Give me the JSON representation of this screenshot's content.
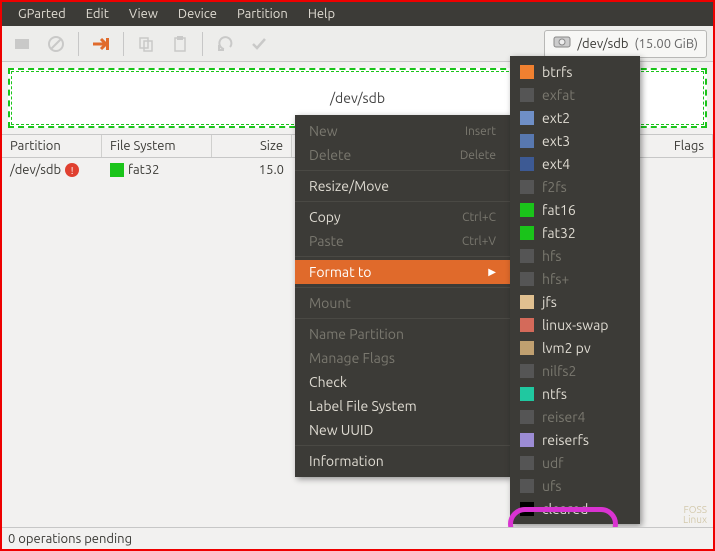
{
  "menubar": [
    "GParted",
    "Edit",
    "View",
    "Device",
    "Partition",
    "Help"
  ],
  "toolbar_icons": [
    "new-partition-icon",
    "delete-icon",
    "resize-icon",
    "copy-icon",
    "paste-icon",
    "undo-icon",
    "apply-icon"
  ],
  "device": {
    "name": "/dev/sdb",
    "size": "(15.00 GiB)"
  },
  "graphic": {
    "dev": "/dev/sdb"
  },
  "columns": {
    "partition": "Partition",
    "fs": "File System",
    "size": "Size",
    "flags": "Flags"
  },
  "rows": [
    {
      "partition": "/dev/sdb",
      "warn": true,
      "fs": "fat32",
      "fs_color": "#1ac41a",
      "size": "15.0"
    }
  ],
  "context_menu": [
    {
      "label": "New",
      "accel": "Insert",
      "disabled": true
    },
    {
      "label": "Delete",
      "accel": "Delete",
      "disabled": true
    },
    {
      "sep": true
    },
    {
      "label": "Resize/Move",
      "disabled": false
    },
    {
      "sep": true
    },
    {
      "label": "Copy",
      "accel": "Ctrl+C",
      "disabled": false
    },
    {
      "label": "Paste",
      "accel": "Ctrl+V",
      "disabled": true
    },
    {
      "sep": true
    },
    {
      "label": "Format to",
      "submenu": true,
      "active": true
    },
    {
      "sep": true
    },
    {
      "label": "Mount",
      "disabled": true
    },
    {
      "sep": true
    },
    {
      "label": "Name Partition",
      "disabled": true
    },
    {
      "label": "Manage Flags",
      "disabled": true
    },
    {
      "label": "Check",
      "disabled": false
    },
    {
      "label": "Label File System",
      "disabled": false
    },
    {
      "label": "New UUID",
      "disabled": false
    },
    {
      "sep": true
    },
    {
      "label": "Information",
      "disabled": false
    }
  ],
  "submenu": [
    {
      "label": "btrfs",
      "color": "#f08030",
      "disabled": false
    },
    {
      "label": "exfat",
      "color": "#555",
      "disabled": true
    },
    {
      "label": "ext2",
      "color": "#6f8fc7",
      "disabled": false
    },
    {
      "label": "ext3",
      "color": "#5878b0",
      "disabled": false
    },
    {
      "label": "ext4",
      "color": "#3d5a94",
      "disabled": false
    },
    {
      "label": "f2fs",
      "color": "#555",
      "disabled": true
    },
    {
      "label": "fat16",
      "color": "#1ac41a",
      "disabled": false
    },
    {
      "label": "fat32",
      "color": "#1ac41a",
      "disabled": false
    },
    {
      "label": "hfs",
      "color": "#555",
      "disabled": true
    },
    {
      "label": "hfs+",
      "color": "#555",
      "disabled": true
    },
    {
      "label": "jfs",
      "color": "#e0c090",
      "disabled": false
    },
    {
      "label": "linux-swap",
      "color": "#d46a5a",
      "disabled": false
    },
    {
      "label": "lvm2 pv",
      "color": "#c0a070",
      "disabled": false
    },
    {
      "label": "nilfs2",
      "color": "#555",
      "disabled": true
    },
    {
      "label": "ntfs",
      "color": "#20c8a0",
      "disabled": false
    },
    {
      "label": "reiser4",
      "color": "#555",
      "disabled": true
    },
    {
      "label": "reiserfs",
      "color": "#9c8cd4",
      "disabled": false
    },
    {
      "label": "udf",
      "color": "#555",
      "disabled": true
    },
    {
      "label": "ufs",
      "color": "#555",
      "disabled": true
    },
    {
      "label": "cleared",
      "color": "#000000",
      "disabled": false
    }
  ],
  "status": "0 operations pending",
  "watermark": {
    "l1": "FOSS",
    "l2": "Linux"
  }
}
